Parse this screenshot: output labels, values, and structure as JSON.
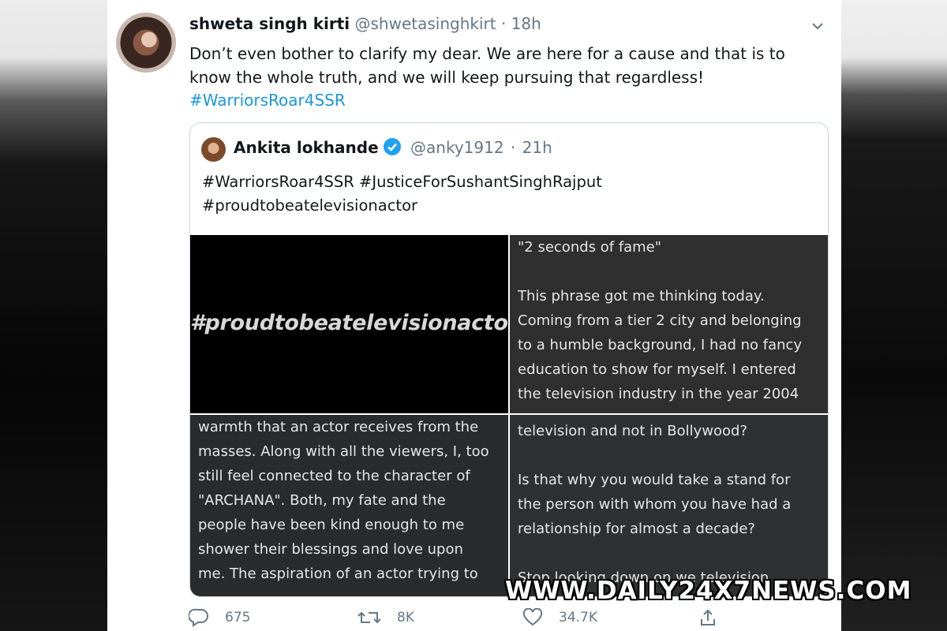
{
  "tweet": {
    "author_name": "shweta singh kirti",
    "author_handle": "@shwetasinghkirt",
    "separator": "·",
    "time": "18h",
    "text": "Don’t even bother to clarify my dear. We are here for a cause and that is to know the whole truth, and we will keep pursuing that regardless!",
    "hashtag": "#WarriorsRoar4SSR"
  },
  "quoted_tweet": {
    "author_name": "Ankita lokhande",
    "author_handle": "@anky1912",
    "separator": "·",
    "time": "21h",
    "text": "#WarriorsRoar4SSR #JusticeForSushantSinghRajput #proudtobeatelevisionactor",
    "images": {
      "cell1": "#proudtobeatelevisionactor",
      "cell2": "\"2 seconds of fame\"\n\nThis phrase got me thinking today.\nComing from a tier 2 city and belonging\nto a humble background, I had no fancy\neducation to show for myself. I entered\nthe television industry in the year 2004",
      "cell3": "warmth that an actor receives from the\nmasses. Along with all the viewers, I, too\nstill feel connected to the character of\n\"ARCHANA\". Both, my fate and the\npeople have been kind enough to me\nshower their blessings and love upon\nme. The aspiration of an actor trying to",
      "cell4": "television and not in Bollywood?\n\nIs that why you would take a stand for\nthe person with whom you have had a\nrelationship for almost a decade?\n\nStop looking down on we television"
    }
  },
  "actions": {
    "replies": "675",
    "retweets": "8K",
    "likes": "34.7K"
  },
  "watermark": "WWW.DAILY24X7NEWS.COM",
  "icons": {
    "caret": "chevron-down-icon",
    "verified": "verified-badge-icon",
    "reply": "reply-icon",
    "retweet": "retweet-icon",
    "like": "heart-icon",
    "share": "share-icon"
  },
  "colors": {
    "hashtag": "#1b95e0",
    "verified": "#1da1f2",
    "secondary_text": "#657786"
  }
}
